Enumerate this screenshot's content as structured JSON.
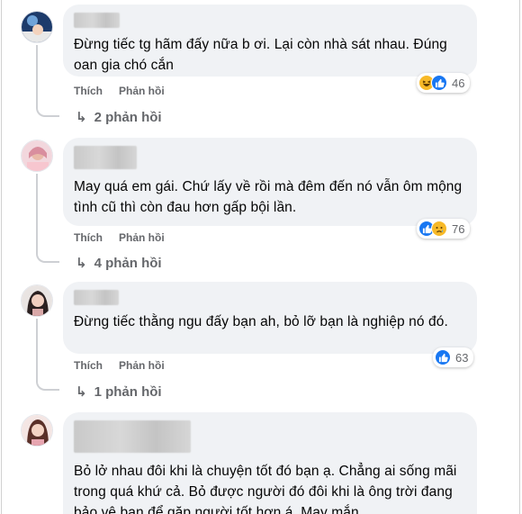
{
  "comments": [
    {
      "text": "Đừng tiếc tg hãm đấy nữa b ơi. Lại còn nhà sát nhau. Đúng oan gia chó cắn",
      "like_label": "Thích",
      "reply_label": "Phản hồi",
      "reactions": [
        "haha-icon",
        "like-icon"
      ],
      "reaction_count": "46",
      "replies_label": "2 phản hồi"
    },
    {
      "text": "May quá em gái. Chứ lấy về rồi mà đêm đến nó vẫn ôm mộng tình cũ thì còn đau hơn gấp bội lần.",
      "like_label": "Thích",
      "reply_label": "Phản hồi",
      "reactions": [
        "like-icon",
        "sad-icon"
      ],
      "reaction_count": "76",
      "replies_label": "4 phản hồi"
    },
    {
      "text": "Đừng tiếc thằng ngu đấy bạn ah, bỏ lỡ bạn là nghiệp nó đó.",
      "like_label": "Thích",
      "reply_label": "Phản hồi",
      "reactions": [
        "like-icon"
      ],
      "reaction_count": "63",
      "replies_label": "1 phản hồi"
    },
    {
      "text": "Bỏ lở nhau đôi khi là chuyện tốt đó bạn ạ. Chẳng ai sống mãi trong quá khứ cả. Bỏ được người đó đôi khi là ông trời đang bảo vệ bạn để gặp người tốt hơn á. May mắn"
    }
  ],
  "colors": {
    "bubble": "#f0f2f5",
    "meta": "#65676b",
    "like_blue": "#1877f2",
    "haha_yellow": "#f7b928"
  }
}
